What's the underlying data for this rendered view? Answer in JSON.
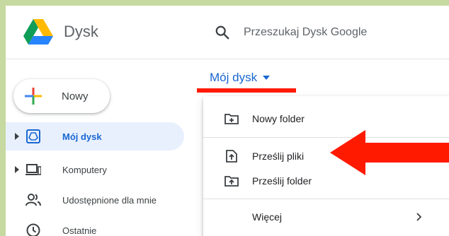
{
  "header": {
    "app_title": "Dysk",
    "search_placeholder": "Przeszukaj Dysk Google"
  },
  "sidebar": {
    "new_button_label": "Nowy",
    "items": [
      {
        "label": "Mój dysk",
        "icon": "drive-icon",
        "active": true,
        "expandable": true
      },
      {
        "label": "Komputery",
        "icon": "computer-icon",
        "active": false,
        "expandable": true
      },
      {
        "label": "Udostępnione dla mnie",
        "icon": "people-icon",
        "active": false,
        "expandable": false
      },
      {
        "label": "Ostatnie",
        "icon": "clock-icon",
        "active": false,
        "expandable": false
      }
    ]
  },
  "main": {
    "location_title": "Mój dysk"
  },
  "menu": {
    "items": [
      {
        "label": "Nowy folder",
        "icon": "new-folder-icon"
      },
      {
        "label": "Prześlij pliki",
        "icon": "file-upload-icon"
      },
      {
        "label": "Prześlij folder",
        "icon": "folder-upload-icon"
      },
      {
        "label": "Więcej",
        "icon": "chevron-right-icon"
      }
    ]
  },
  "colors": {
    "accent_blue": "#1967d2",
    "annotation_red": "#ff1a00",
    "active_bg": "#e8f0fe",
    "frame_border": "#c5d9a0"
  }
}
